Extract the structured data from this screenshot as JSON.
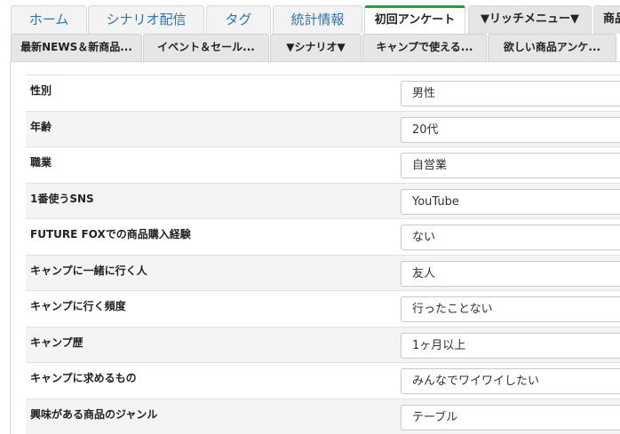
{
  "tabs_row1": [
    {
      "label": "ホーム"
    },
    {
      "label": "シナリオ配信"
    },
    {
      "label": "タグ"
    },
    {
      "label": "統計情報"
    },
    {
      "label": "初回アンケート",
      "active": true
    },
    {
      "label": "▼リッチメニュー▼"
    },
    {
      "label": "商品"
    }
  ],
  "tabs_row2": [
    {
      "label": "最新NEWS＆新商品..."
    },
    {
      "label": "イベント＆セール..."
    },
    {
      "label": "▼シナリオ▼"
    },
    {
      "label": "キャンプで使える..."
    },
    {
      "label": "欲しい商品アンケ..."
    }
  ],
  "survey": [
    {
      "question": "性別",
      "answer": "男性"
    },
    {
      "question": "年齢",
      "answer": "20代"
    },
    {
      "question": "職業",
      "answer": "自営業"
    },
    {
      "question": "1番使うSNS",
      "answer": "YouTube"
    },
    {
      "question": "FUTURE FOXでの商品購入経験",
      "answer": "ない"
    },
    {
      "question": "キャンプに一緒に行く人",
      "answer": "友人"
    },
    {
      "question": "キャンプに行く頻度",
      "answer": "行ったことない"
    },
    {
      "question": "キャンプ歴",
      "answer": "1ヶ月以上"
    },
    {
      "question": "キャンプに求めるもの",
      "answer": "みんなでワイワイしたい"
    },
    {
      "question": "興味がある商品のジャンル",
      "answer": "テーブル"
    }
  ],
  "colors": {
    "tab_link": "#2f73b6",
    "active_tab_accent": "#2e9a3c",
    "row_alt_bg": "#f4f4f4"
  }
}
